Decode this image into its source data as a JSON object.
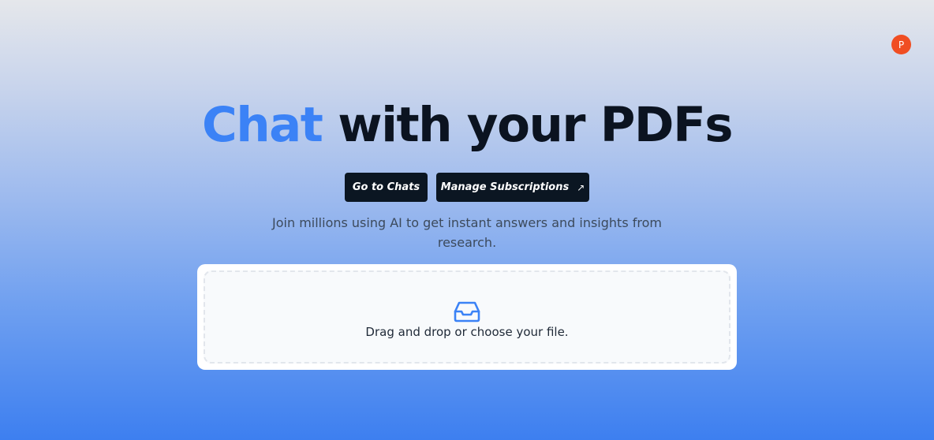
{
  "header": {
    "avatar_initial": "P"
  },
  "hero": {
    "title_accent": "Chat",
    "title_rest": "with your PDFs"
  },
  "actions": {
    "go_to_chats": "Go to Chats",
    "manage_subscriptions": "Manage Subscriptions",
    "external_arrow": "↗"
  },
  "tagline": "Join millions using AI to get instant answers and insights from research.",
  "upload": {
    "icon": "inbox-icon",
    "label": "Drag and drop or choose your file."
  },
  "colors": {
    "accent": "#3b82f6",
    "avatar": "#f04e23",
    "button": "#0b1622",
    "heading": "#0b1320"
  }
}
